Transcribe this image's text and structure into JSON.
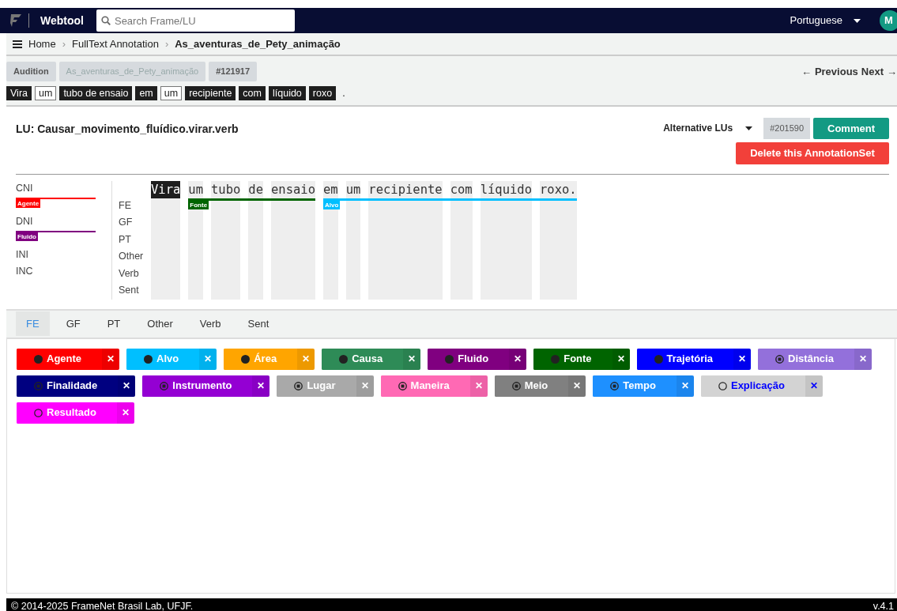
{
  "navbar": {
    "brand": "Webtool",
    "search": {
      "placeholder": "Search Frame/LU"
    },
    "language": "Portuguese",
    "avatar": "M"
  },
  "breadcrumb_separator": "›",
  "breadcrumb": [
    {
      "label": "Home",
      "link": true
    },
    {
      "label": "FullText Annotation",
      "link": true
    },
    {
      "label": "As_aventuras_de_Pety_animação",
      "link": false
    }
  ],
  "tags": [
    "Audition",
    "As_aventuras_de_Pety_animação",
    "#121917"
  ],
  "pager": {
    "left_arrow": "←",
    "previous": "Previous",
    "next": "Next",
    "right_arrow": "→"
  },
  "sentence": [
    {
      "text": "Vira",
      "kind": "filled"
    },
    {
      "text": "um",
      "kind": "outlined"
    },
    {
      "text": "tubo de ensaio",
      "kind": "filled"
    },
    {
      "text": "em",
      "kind": "filled"
    },
    {
      "text": "um",
      "kind": "outlined"
    },
    {
      "text": "recipiente",
      "kind": "filled"
    },
    {
      "text": "com",
      "kind": "filled"
    },
    {
      "text": "líquido",
      "kind": "filled"
    },
    {
      "text": "roxo",
      "kind": "filled"
    },
    {
      "text": ".",
      "kind": "plain"
    }
  ],
  "lu": {
    "title": "LU: Causar_movimento_fluídico.virar.verb",
    "alternatives": "Alternative LUs",
    "id": "#201590",
    "comment": "Comment",
    "delete": "Delete this AnnotationSet"
  },
  "null_instantiation": [
    {
      "label": "CNI",
      "fe": {
        "name": "Agente",
        "color": "#ff0000"
      }
    },
    {
      "label": "DNI",
      "fe": {
        "name": "Fluido",
        "color": "#800080"
      }
    },
    {
      "label": "INI"
    },
    {
      "label": "INC"
    }
  ],
  "layers": [
    "FE",
    "GF",
    "PT",
    "Other",
    "Verb",
    "Sent"
  ],
  "segments": [
    {
      "words": [
        {
          "text": "Vira",
          "target": true
        }
      ]
    },
    {
      "fe": {
        "label": "Fonte",
        "color": "#006400"
      },
      "words": [
        {
          "text": "um",
          "target": false
        },
        {
          "text": "tubo",
          "target": false
        },
        {
          "text": "de",
          "target": false
        },
        {
          "text": "ensaio",
          "target": false
        }
      ]
    },
    {
      "fe": {
        "label": "Alvo",
        "color": "#00bfff"
      },
      "words": [
        {
          "text": "em",
          "target": false
        },
        {
          "text": "um",
          "target": false
        },
        {
          "text": "recipiente",
          "target": false
        },
        {
          "text": "com",
          "target": false
        },
        {
          "text": "líquido",
          "target": false
        },
        {
          "text": "roxo.",
          "target": false
        }
      ]
    }
  ],
  "tabs": [
    {
      "label": "FE",
      "selected": true
    },
    {
      "label": "GF",
      "selected": false
    },
    {
      "label": "PT",
      "selected": false
    },
    {
      "label": "Other",
      "selected": false
    },
    {
      "label": "Verb",
      "selected": false
    },
    {
      "label": "Sent",
      "selected": false
    }
  ],
  "frame_elements": [
    {
      "name": "Agente",
      "color": "#ff0000",
      "kind": "core"
    },
    {
      "name": "Alvo",
      "color": "#00bfff",
      "kind": "core"
    },
    {
      "name": "Área",
      "color": "#ffa500",
      "kind": "core"
    },
    {
      "name": "Causa",
      "color": "#2e8b57",
      "kind": "core"
    },
    {
      "name": "Fluido",
      "color": "#800080",
      "kind": "core"
    },
    {
      "name": "Fonte",
      "color": "#006400",
      "kind": "core"
    },
    {
      "name": "Trajetória",
      "color": "#0000ff",
      "kind": "core"
    },
    {
      "name": "Distância",
      "color": "#9370db",
      "kind": "peripheral"
    },
    {
      "name": "Finalidade",
      "color": "#000080",
      "kind": "peripheral"
    },
    {
      "name": "Instrumento",
      "color": "#9400d3",
      "kind": "peripheral"
    },
    {
      "name": "Lugar",
      "color": "#a9a9a9",
      "kind": "peripheral"
    },
    {
      "name": "Maneira",
      "color": "#ff69b4",
      "kind": "peripheral"
    },
    {
      "name": "Meio",
      "color": "#808080",
      "kind": "peripheral"
    },
    {
      "name": "Tempo",
      "color": "#1e90ff",
      "kind": "peripheral"
    },
    {
      "name": "Explicação",
      "color": "#d3d3d3",
      "kind": "extra",
      "label": {
        "color": "#0000ff"
      }
    },
    {
      "name": "Resultado",
      "color": "#ff00ff",
      "kind": "extra"
    }
  ],
  "close_mark": "✕",
  "footer": {
    "copyright": "© 2014-2025 FrameNet Brasil Lab, UFJF.",
    "version": "v.4.1"
  }
}
